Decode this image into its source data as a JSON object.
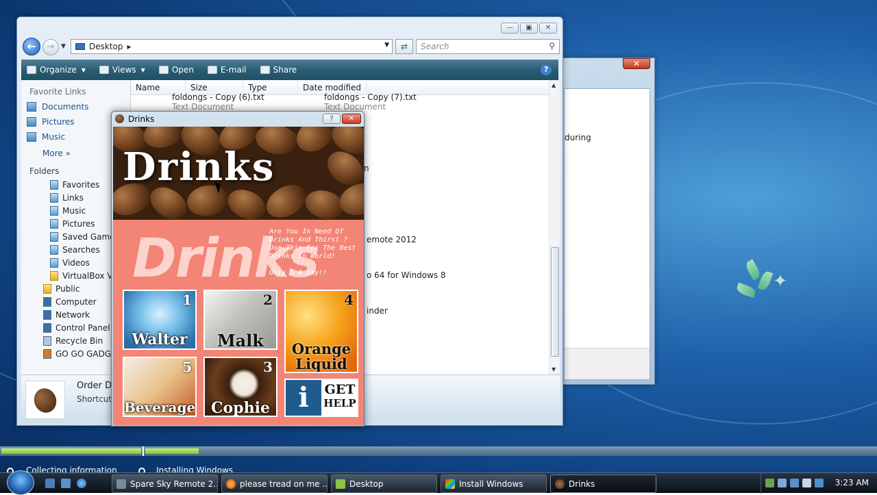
{
  "explorer": {
    "location": "Desktop",
    "search_placeholder": "Search",
    "commands": [
      "Organize",
      "Views",
      "Open",
      "E-mail",
      "Share"
    ],
    "favorite_links_header": "Favorite Links",
    "favorite_links": [
      "Documents",
      "Pictures",
      "Music"
    ],
    "more_label": "More",
    "folders_header": "Folders",
    "folders": [
      "Favorites",
      "Links",
      "Music",
      "Pictures",
      "Saved Games",
      "Searches",
      "Videos",
      "VirtualBox VMs",
      "Public",
      "Computer",
      "Network",
      "Control Panel",
      "Recycle Bin",
      "GO GO GADGET"
    ],
    "columns": [
      "Name",
      "Size",
      "Type",
      "Date modified"
    ],
    "file_rows": [
      {
        "name": "foldongs - Copy (6).txt",
        "type": "Text Document"
      },
      {
        "name": "foldongs - Copy (7).txt",
        "type": "Text Document"
      }
    ],
    "partial_names": [
      "n",
      "emote 2012",
      "o 64 for Windows 8",
      "inder"
    ],
    "details": {
      "title": "Order Dr",
      "subtitle": "Shortcut"
    }
  },
  "back_dialog": {
    "partial_text": "during"
  },
  "drinks_window": {
    "title": "Drinks",
    "help_button": "?",
    "banner_title": "Drinks",
    "big_word": "Drinks",
    "tagline": "Are You In Need Of Drinks And Thirst ? Use This For The Best Drinks In World!",
    "tagline_price": "Only 5 A Day!!",
    "tiles": [
      {
        "label": "Walter",
        "number": "1"
      },
      {
        "label": "Malk",
        "number": "2"
      },
      {
        "label_line1": "Orange",
        "label_line2": "Liquid",
        "number": "4"
      },
      {
        "label": "Beverage",
        "number": "5"
      },
      {
        "label": "Cophie",
        "number": "3"
      }
    ],
    "help_tile": {
      "icon": "i",
      "line1": "GET",
      "line2": "HELP"
    }
  },
  "install": {
    "steps": [
      "Collecting information",
      "Installing Windows"
    ]
  },
  "taskbar": {
    "tasks": [
      "Spare Sky Remote 2...",
      "please tread on me ...",
      "Desktop",
      "Install Windows",
      "Drinks"
    ],
    "clock": "3:23 AM"
  }
}
